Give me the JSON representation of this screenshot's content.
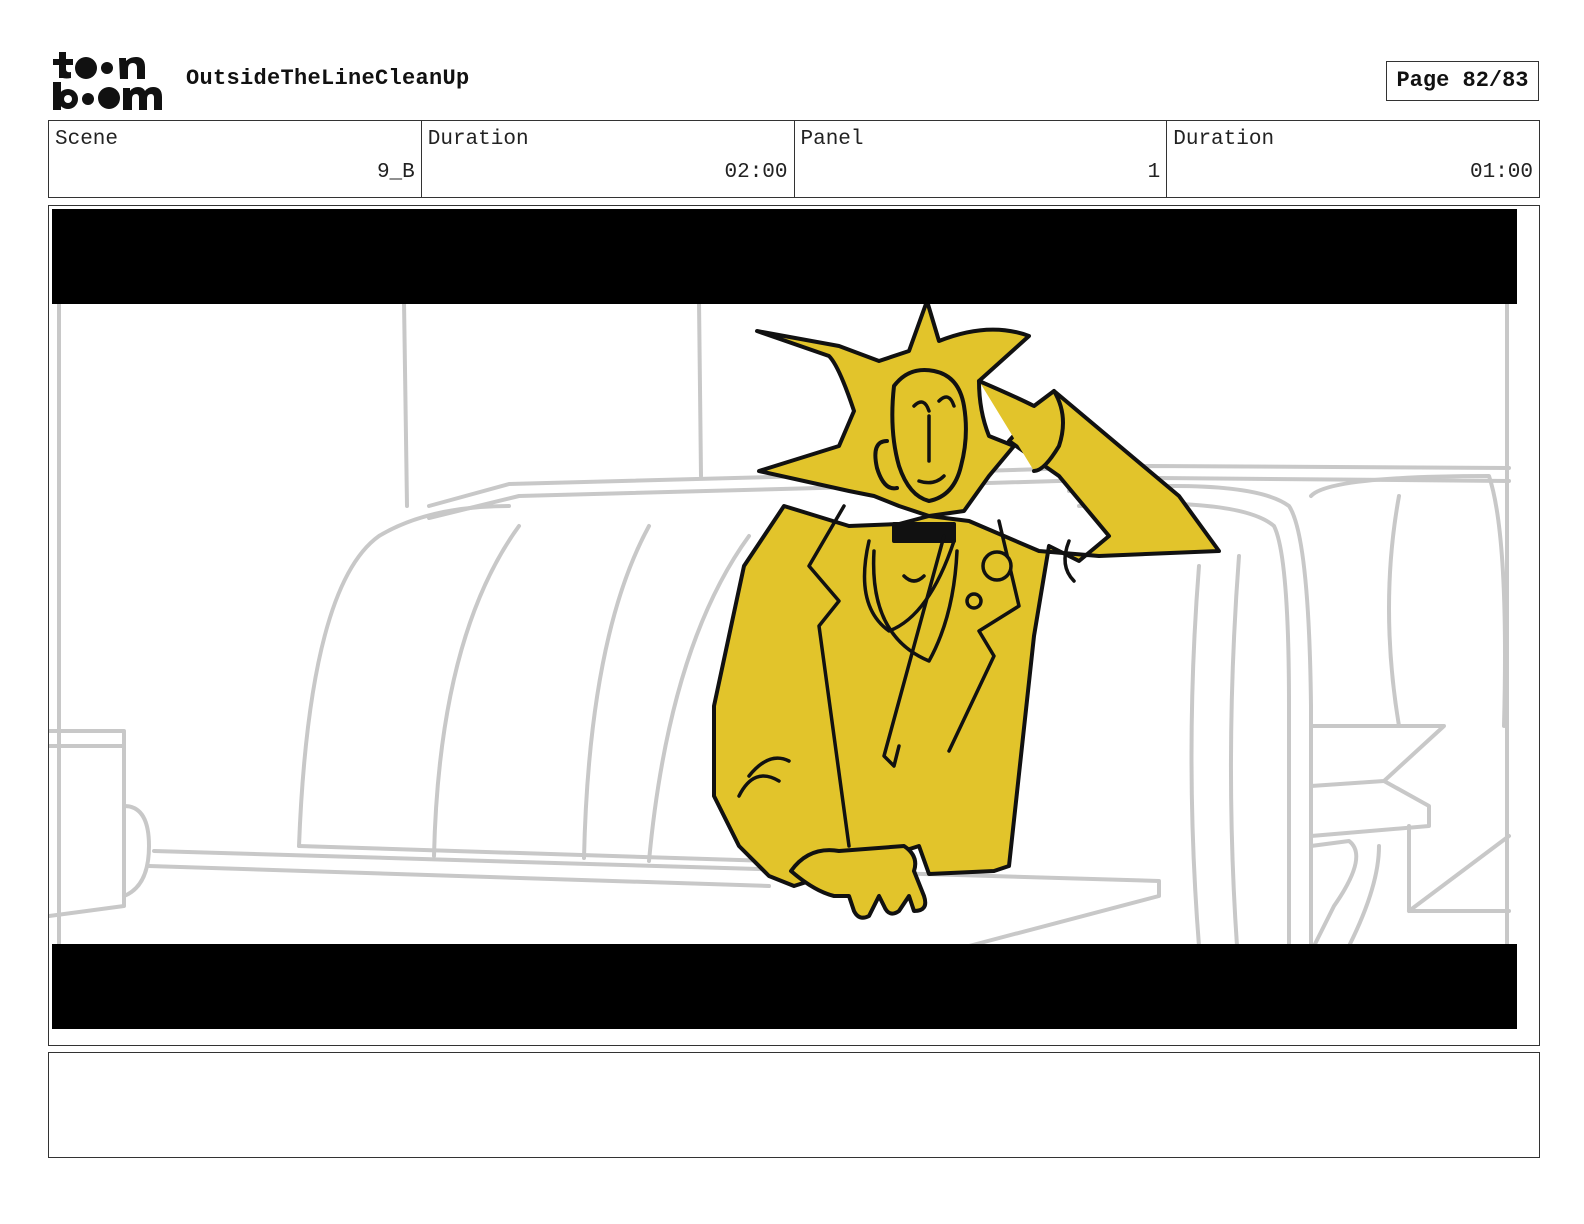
{
  "header": {
    "logo": {
      "icon": "toon-boom-logo",
      "text_line1": "toon",
      "text_line2": "boom"
    },
    "project_title": "OutsideTheLineCleanUp",
    "page_label": "Page 82/83"
  },
  "info": {
    "scene_label": "Scene",
    "scene_value": "9_B",
    "scene_duration_label": "Duration",
    "scene_duration_value": "02:00",
    "panel_label": "Panel",
    "panel_value": "1",
    "panel_duration_label": "Duration",
    "panel_duration_value": "01:00"
  },
  "panel": {
    "image": "storyboard-frame",
    "description_icon": "yellow-character-in-diner-booth",
    "colors": {
      "character": "#e2c42b",
      "letterbox": "#000000",
      "background_lines": "#c8c8c8",
      "outline": "#111111"
    }
  },
  "notes": {
    "text": ""
  }
}
